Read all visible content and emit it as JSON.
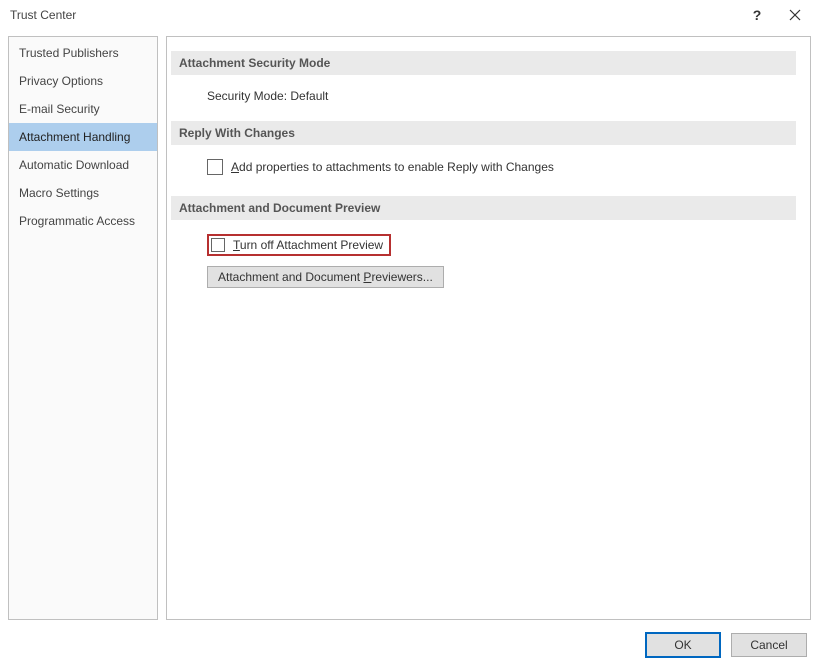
{
  "window": {
    "title": "Trust Center"
  },
  "sidebar": {
    "items": [
      {
        "label": "Trusted Publishers"
      },
      {
        "label": "Privacy Options"
      },
      {
        "label": "E-mail Security"
      },
      {
        "label": "Attachment Handling"
      },
      {
        "label": "Automatic Download"
      },
      {
        "label": "Macro Settings"
      },
      {
        "label": "Programmatic Access"
      }
    ],
    "selected_index": 3
  },
  "content": {
    "section1": {
      "heading": "Attachment Security Mode",
      "text": "Security Mode: Default"
    },
    "section2": {
      "heading": "Reply With Changes",
      "checkbox_hotkey": "A",
      "checkbox_rest": "dd properties to attachments to enable Reply with Changes"
    },
    "section3": {
      "heading": "Attachment and Document Preview",
      "checkbox_hotkey": "T",
      "checkbox_rest": "urn off Attachment Preview",
      "button_pre": "Attachment and Document ",
      "button_hotkey": "P",
      "button_post": "reviewers..."
    }
  },
  "footer": {
    "ok": "OK",
    "cancel": "Cancel"
  }
}
